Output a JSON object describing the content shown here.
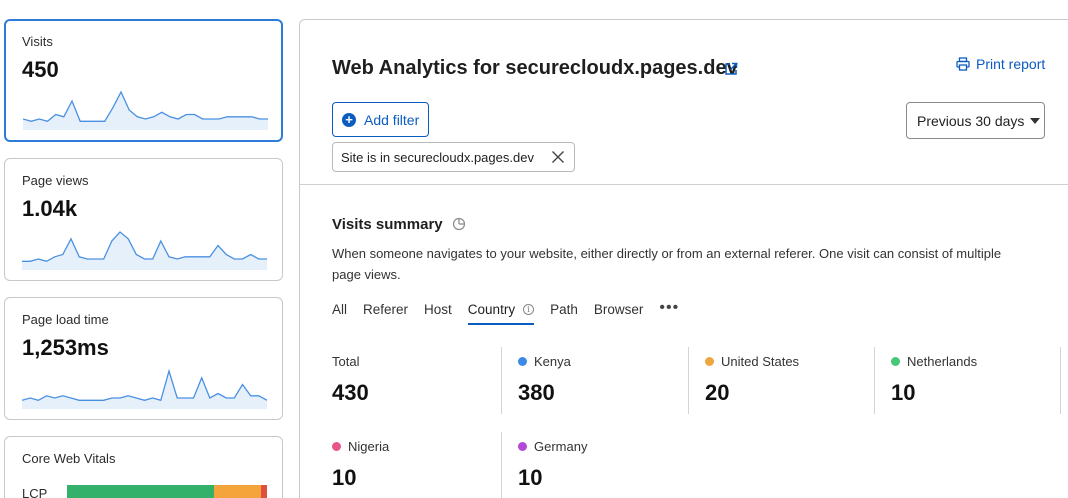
{
  "metrics": {
    "visits": {
      "label": "Visits",
      "value": "450",
      "spark": [
        4,
        3,
        4,
        3,
        6,
        5,
        12,
        3,
        3,
        3,
        3,
        9,
        16,
        8,
        5,
        4,
        5,
        7,
        5,
        4,
        6,
        6,
        4,
        4,
        4,
        5,
        5,
        5,
        5,
        4,
        4
      ]
    },
    "pageviews": {
      "label": "Page views",
      "value": "1.04k",
      "spark": [
        3,
        3,
        4,
        3,
        5,
        6,
        13,
        5,
        4,
        4,
        4,
        12,
        16,
        13,
        6,
        4,
        4,
        12,
        5,
        4,
        5,
        5,
        5,
        5,
        10,
        6,
        4,
        4,
        6,
        4,
        4
      ]
    },
    "loadtime": {
      "label": "Page load time",
      "value": "1,253ms",
      "spark": [
        3,
        4,
        3,
        5,
        4,
        5,
        4,
        3,
        3,
        3,
        3,
        4,
        4,
        5,
        4,
        3,
        4,
        3,
        16,
        4,
        4,
        4,
        13,
        4,
        6,
        4,
        4,
        10,
        5,
        5,
        3
      ]
    },
    "cwv": {
      "label": "Core Web Vitals",
      "lcp_label": "LCP",
      "lcp_segments": [
        0.735,
        0.235,
        0.03
      ]
    }
  },
  "header": {
    "title": "Web Analytics for securecloudx.pages.dev",
    "print_label": "Print report",
    "add_filter_label": "Add filter",
    "date_range": "Previous 30 days",
    "filter_chip": "Site is in securecloudx.pages.dev"
  },
  "summary": {
    "title": "Visits summary",
    "description": "When someone navigates to your website, either directly or from an external referer. One visit can consist of multiple page views.",
    "tabs": [
      "All",
      "Referer",
      "Host",
      "Country",
      "Path",
      "Browser"
    ],
    "active_tab": "Country",
    "stats": [
      {
        "label": "Total",
        "value": "430",
        "color": ""
      },
      {
        "label": "Kenya",
        "value": "380",
        "color": "#3d8ae6"
      },
      {
        "label": "United States",
        "value": "20",
        "color": "#f0a640"
      },
      {
        "label": "Netherlands",
        "value": "10",
        "color": "#47c77a"
      },
      {
        "label": "Nigeria",
        "value": "10",
        "color": "#e8558c"
      },
      {
        "label": "Germany",
        "value": "10",
        "color": "#b347d6"
      }
    ]
  },
  "colors": {
    "accent": "#0b5cc1",
    "spark_line": "#4a90e2",
    "lcp_good": "#33b16a",
    "lcp_needs": "#f5a33b",
    "lcp_poor": "#e04e3c"
  },
  "icons": [
    "external-link-icon",
    "printer-icon",
    "plus-circle-icon",
    "chevron-down-icon",
    "close-icon",
    "pie-chart-icon",
    "info-icon",
    "more-icon"
  ]
}
